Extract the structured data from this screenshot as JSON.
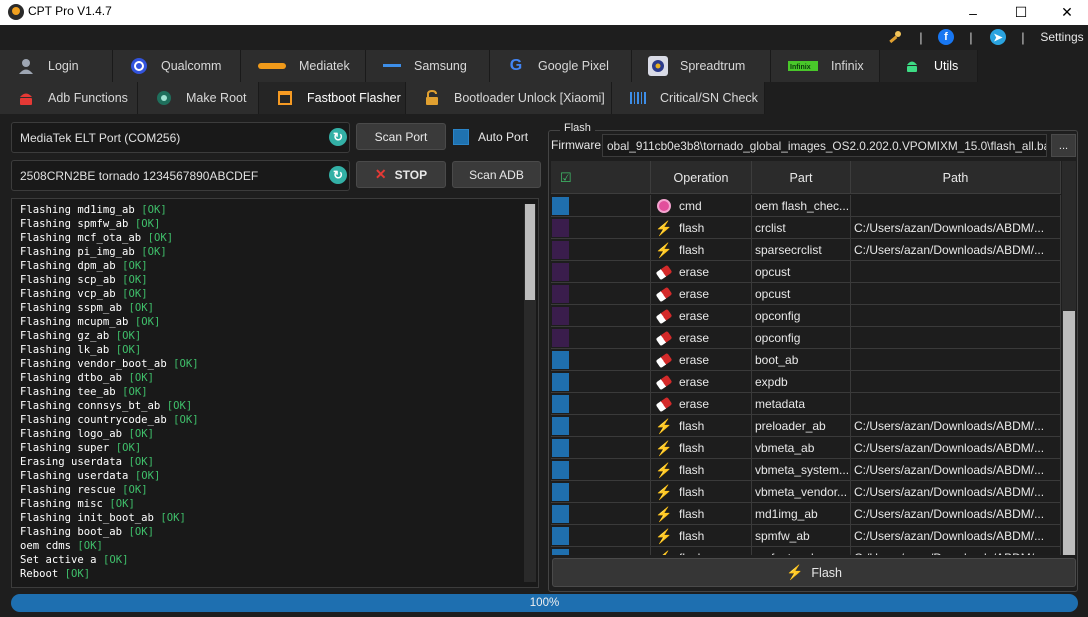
{
  "window": {
    "title": "CPT Pro V1.4.7"
  },
  "topbar": {
    "settings_label": "Settings",
    "separator": "|"
  },
  "tabs_primary": [
    {
      "label": "Login",
      "icon": "user-icon",
      "active": false
    },
    {
      "label": "Qualcomm",
      "icon": "qualcomm-icon",
      "active": false
    },
    {
      "label": "Mediatek",
      "icon": "mediatek-icon",
      "active": false
    },
    {
      "label": "Samsung",
      "icon": "samsung-icon",
      "active": false
    },
    {
      "label": "Google Pixel",
      "icon": "google-icon",
      "active": false
    },
    {
      "label": "Spreadtrum",
      "icon": "spreadtrum-icon",
      "active": false
    },
    {
      "label": "Infinix",
      "icon": "infinix-icon",
      "active": false
    },
    {
      "label": "Utils",
      "icon": "android-icon",
      "active": true
    }
  ],
  "tabs_secondary": [
    {
      "label": "Adb Functions",
      "icon": "adb-icon",
      "active": false
    },
    {
      "label": "Make Root",
      "icon": "root-icon",
      "active": false
    },
    {
      "label": "Fastboot Flasher",
      "icon": "fastboot-icon",
      "active": true
    },
    {
      "label": "Bootloader Unlock [Xiaomi]",
      "icon": "lock-icon",
      "active": false
    },
    {
      "label": "Critical/SN Check",
      "icon": "barcode-icon",
      "active": false
    }
  ],
  "connection": {
    "port_value": "MediaTek ELT Port (COM256)",
    "scan_port_label": "Scan Port",
    "auto_port_label": "Auto Port",
    "device_value": "2508CRN2BE tornado 1234567890ABCDEF",
    "stop_label": "STOP",
    "scan_adb_label": "Scan ADB"
  },
  "log": [
    {
      "text": "Flashing md1img_ab",
      "status": "[OK]"
    },
    {
      "text": "Flashing spmfw_ab",
      "status": "[OK]"
    },
    {
      "text": "Flashing mcf_ota_ab",
      "status": "[OK]"
    },
    {
      "text": "Flashing pi_img_ab",
      "status": "[OK]"
    },
    {
      "text": "Flashing dpm_ab",
      "status": "[OK]"
    },
    {
      "text": "Flashing scp_ab",
      "status": "[OK]"
    },
    {
      "text": "Flashing vcp_ab",
      "status": "[OK]"
    },
    {
      "text": "Flashing sspm_ab",
      "status": "[OK]"
    },
    {
      "text": "Flashing mcupm_ab",
      "status": "[OK]"
    },
    {
      "text": "Flashing gz_ab",
      "status": "[OK]"
    },
    {
      "text": "Flashing lk_ab",
      "status": "[OK]"
    },
    {
      "text": "Flashing vendor_boot_ab",
      "status": "[OK]"
    },
    {
      "text": "Flashing dtbo_ab",
      "status": "[OK]"
    },
    {
      "text": "Flashing tee_ab",
      "status": "[OK]"
    },
    {
      "text": "Flashing connsys_bt_ab",
      "status": "[OK]"
    },
    {
      "text": "Flashing countrycode_ab",
      "status": "[OK]"
    },
    {
      "text": "Flashing logo_ab",
      "status": "[OK]"
    },
    {
      "text": "Flashing super",
      "status": "[OK]"
    },
    {
      "text": "Erasing userdata",
      "status": "[OK]"
    },
    {
      "text": "Flashing userdata",
      "status": "[OK]"
    },
    {
      "text": "Flashing rescue",
      "status": "[OK]"
    },
    {
      "text": "Flashing misc",
      "status": "[OK]"
    },
    {
      "text": "Flashing init_boot_ab",
      "status": "[OK]"
    },
    {
      "text": "Flashing boot_ab",
      "status": "[OK]"
    },
    {
      "text": "oem cdms",
      "status": "[OK]"
    },
    {
      "text": "Set active a",
      "status": "[OK]"
    },
    {
      "text": "Reboot",
      "status": "[OK]"
    }
  ],
  "flash_panel": {
    "group_title": "Flash",
    "firmware_label": "Firmware",
    "firmware_path": "obal_911cb0e3b8\\tornado_global_images_OS2.0.202.0.VPOMIXM_15.0\\flash_all.bat",
    "browse_label": "...",
    "columns": [
      "",
      "Operation",
      "Part",
      "Path"
    ],
    "rows": [
      {
        "selected_color": "#1f6fae",
        "operation": "cmd",
        "icon": "cmd-icon",
        "part": "oem flash_chec...",
        "path": ""
      },
      {
        "selected_color": "#3a1d4c",
        "operation": "flash",
        "icon": "flash-icon",
        "part": "crclist",
        "path": "C:/Users/azan/Downloads/ABDM/..."
      },
      {
        "selected_color": "#3a1d4c",
        "operation": "flash",
        "icon": "flash-icon",
        "part": "sparsecrclist",
        "path": "C:/Users/azan/Downloads/ABDM/..."
      },
      {
        "selected_color": "#3a1d4c",
        "operation": "erase",
        "icon": "eraser-icon",
        "part": "opcust",
        "path": ""
      },
      {
        "selected_color": "#3a1d4c",
        "operation": "erase",
        "icon": "eraser-icon",
        "part": "opcust",
        "path": ""
      },
      {
        "selected_color": "#3a1d4c",
        "operation": "erase",
        "icon": "eraser-icon",
        "part": "opconfig",
        "path": ""
      },
      {
        "selected_color": "#3a1d4c",
        "operation": "erase",
        "icon": "eraser-icon",
        "part": "opconfig",
        "path": ""
      },
      {
        "selected_color": "#1f6fae",
        "operation": "erase",
        "icon": "eraser-icon",
        "part": "boot_ab",
        "path": ""
      },
      {
        "selected_color": "#1f6fae",
        "operation": "erase",
        "icon": "eraser-icon",
        "part": "expdb",
        "path": ""
      },
      {
        "selected_color": "#1f6fae",
        "operation": "erase",
        "icon": "eraser-icon",
        "part": "metadata",
        "path": ""
      },
      {
        "selected_color": "#1f6fae",
        "operation": "flash",
        "icon": "flash-icon",
        "part": "preloader_ab",
        "path": "C:/Users/azan/Downloads/ABDM/..."
      },
      {
        "selected_color": "#1f6fae",
        "operation": "flash",
        "icon": "flash-icon",
        "part": "vbmeta_ab",
        "path": "C:/Users/azan/Downloads/ABDM/..."
      },
      {
        "selected_color": "#1f6fae",
        "operation": "flash",
        "icon": "flash-icon",
        "part": "vbmeta_system...",
        "path": "C:/Users/azan/Downloads/ABDM/..."
      },
      {
        "selected_color": "#1f6fae",
        "operation": "flash",
        "icon": "flash-icon",
        "part": "vbmeta_vendor...",
        "path": "C:/Users/azan/Downloads/ABDM/..."
      },
      {
        "selected_color": "#1f6fae",
        "operation": "flash",
        "icon": "flash-icon",
        "part": "md1img_ab",
        "path": "C:/Users/azan/Downloads/ABDM/..."
      },
      {
        "selected_color": "#1f6fae",
        "operation": "flash",
        "icon": "flash-icon",
        "part": "spmfw_ab",
        "path": "C:/Users/azan/Downloads/ABDM/..."
      },
      {
        "selected_color": "#1f6fae",
        "operation": "flash",
        "icon": "flash-icon",
        "part": "mcf_ota_ab",
        "path": "C:/Users/azan/Downloads/ABDM/..."
      }
    ],
    "flash_button_label": "Flash"
  },
  "progress": {
    "value": 1.0,
    "label": "100%"
  },
  "colors": {
    "accent": "#1e6fb0",
    "ok": "#3fbf6a",
    "bolt": "#f59a23"
  }
}
